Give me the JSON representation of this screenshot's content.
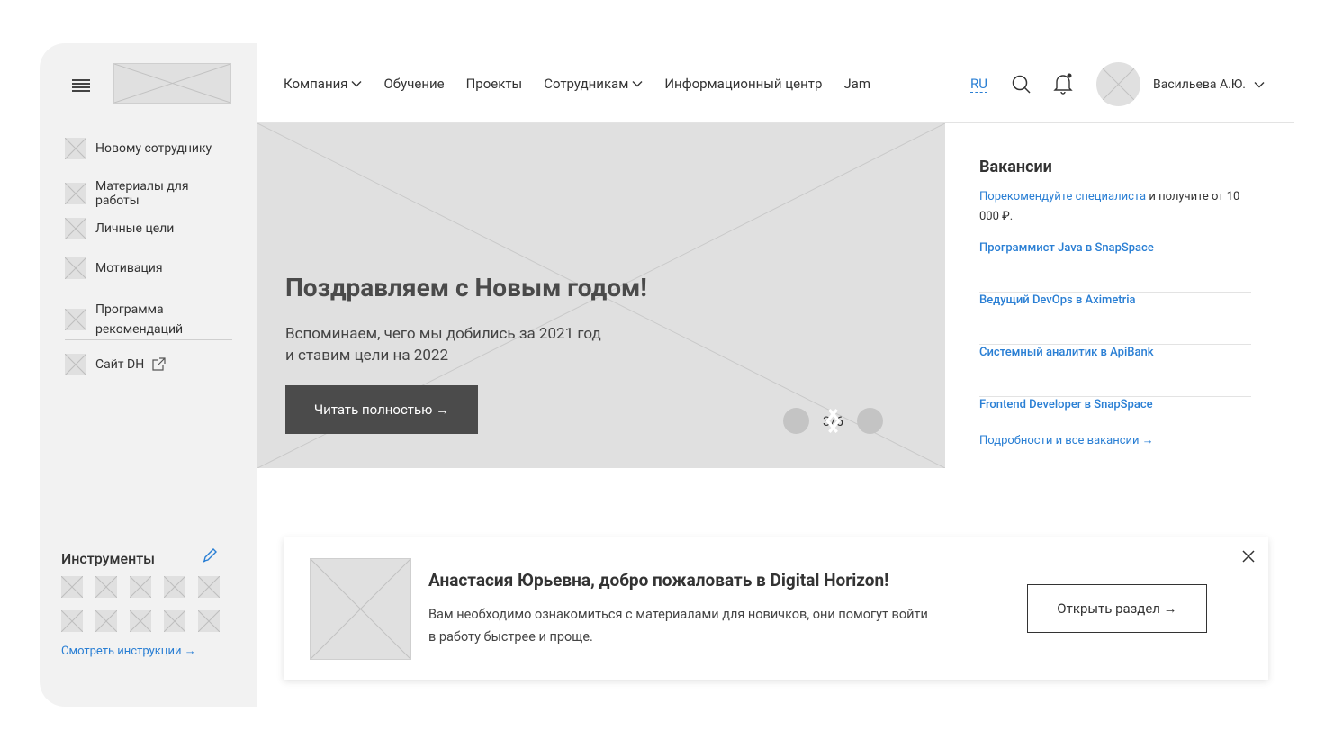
{
  "sidebar": {
    "menu_icon": "hamburger-icon",
    "logo_alt": "logo-placeholder",
    "items": [
      {
        "label": "Новому сотруднику"
      },
      {
        "label": "Материалы для работы"
      },
      {
        "label": "Личные цели"
      },
      {
        "label": "Мотивация"
      },
      {
        "label": "Программа рекомендаций"
      },
      {
        "label": "Сайт DH",
        "icon": "external-link-icon"
      }
    ],
    "tools": {
      "title": "Инструменты",
      "edit_icon": "pencil-icon",
      "link": "Смотреть инструкции →"
    }
  },
  "header": {
    "nav": [
      {
        "label": "Компания",
        "dropdown": true
      },
      {
        "label": "Обучение",
        "dropdown": false
      },
      {
        "label": "Проекты",
        "dropdown": false
      },
      {
        "label": "Сотрудникам",
        "dropdown": true
      },
      {
        "label": "Информационный центр",
        "dropdown": false
      },
      {
        "label": "Jam",
        "dropdown": false
      }
    ],
    "lang": "RU",
    "search_icon": "search-icon",
    "bell_icon": "bell-icon",
    "user_name": "Васильева А.Ю."
  },
  "hero": {
    "title": "Поздравляем с Новым годом!",
    "subtitle_line1": "Вспоминаем, чего мы добились за 2021 год",
    "subtitle_line2": "и ставим цели на 2022",
    "button": "Читать полностью →",
    "pager": "3/6"
  },
  "vacancies": {
    "title": "Вакансии",
    "desc_link": "Порекомендуйте специалиста",
    "desc_rest": " и получите от 10 000 ₽.",
    "items": [
      "Программист Java в SnapSpace",
      "Ведущий DevOps в Aximetria",
      "Системный аналитик в ApiBank",
      "Frontend Developer в SnapSpace"
    ],
    "more": "Подробности и все вакансии →"
  },
  "welcome": {
    "title": "Анастасия Юрьевна, добро пожаловать в Digital Horizon!",
    "text": "Вам необходимо ознакомиться с материалами для новичков, они помогут войти в работу быстрее и проще.",
    "button": "Открыть раздел →"
  },
  "colors": {
    "accent": "#2a7fd4",
    "dark_button": "#4b4b4b",
    "sidebar_bg": "#f2f2f2",
    "placeholder": "#e0e0e0"
  }
}
